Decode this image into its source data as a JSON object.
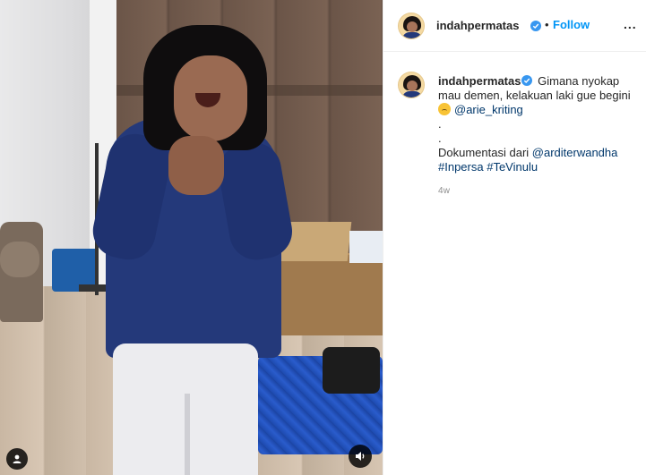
{
  "post": {
    "username": "indahpermatas",
    "follow_label": "Follow",
    "separator": "•",
    "more_label": "...",
    "caption": {
      "line1": "Gimana nyokap",
      "line2": "mau demen, kelakuan laki gue begini",
      "mention1": "@arie_kriting",
      "dot1": ".",
      "dot2": ".",
      "doc_text": "Dokumentasi dari ",
      "mention2": "@arditerwandha",
      "hashtag1": "#Inpersa",
      "hashtag2": "#TeVinulu"
    },
    "timestamp": "4w"
  },
  "media": {
    "type": "video",
    "audio_icon": "speaker-icon",
    "user_tag_icon": "person-icon"
  },
  "colors": {
    "link": "#00376b",
    "follow": "#0095f6",
    "verified": "#3897f0",
    "muted": "#8e8e8e"
  }
}
